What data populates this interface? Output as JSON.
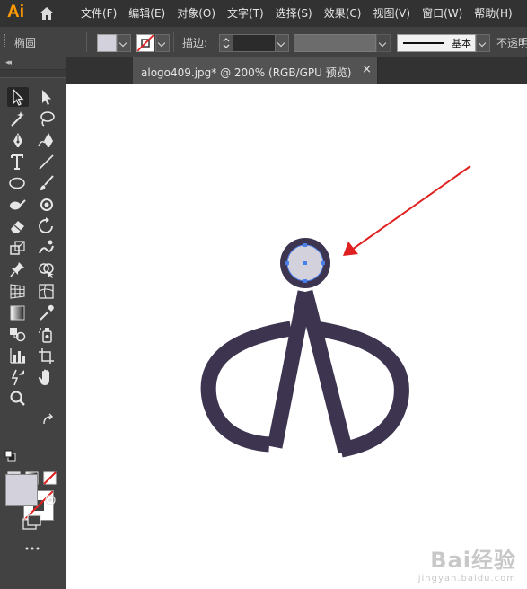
{
  "app": {
    "logo_text": "Ai",
    "menu_items": [
      "文件(F)",
      "编辑(E)",
      "对象(O)",
      "文字(T)",
      "选择(S)",
      "效果(C)",
      "视图(V)",
      "窗口(W)",
      "帮助(H)"
    ]
  },
  "control_bar": {
    "object_type": "椭圆",
    "fill_color": "#d3d1dc",
    "stroke_label": "描边:",
    "stroke_profile_label": "基本",
    "opacity_label": "不透明"
  },
  "document_tab": {
    "title": "alogo409.jpg* @ 200% (RGB/GPU 预览)",
    "close_label": "×"
  },
  "artwork": {
    "shape_color": "#3d3450",
    "selected_fill": "#d3d1dc",
    "selection_color": "#4a7fe8",
    "arrow_color": "#e02020"
  },
  "tools": [
    "selection-tool",
    "direct-selection-tool",
    "magic-wand-tool",
    "lasso-tool",
    "pen-tool",
    "curvature-tool",
    "type-tool",
    "line-tool",
    "ellipse-tool",
    "paintbrush-tool",
    "shaper-tool",
    "blob-brush-tool",
    "eraser-tool",
    "rotate-tool",
    "scale-tool",
    "warp-tool",
    "pin-tool",
    "shape-builder-tool",
    "perspective-grid-tool",
    "mesh-tool",
    "gradient-tool",
    "eyedropper-tool",
    "blend-tool",
    "symbol-sprayer-tool",
    "column-graph-tool",
    "artboard-tool",
    "slice-tool",
    "hand-tool",
    "zoom-tool"
  ],
  "watermark": {
    "brand": "Bai经验",
    "url": "jingyan.baidu.com"
  }
}
